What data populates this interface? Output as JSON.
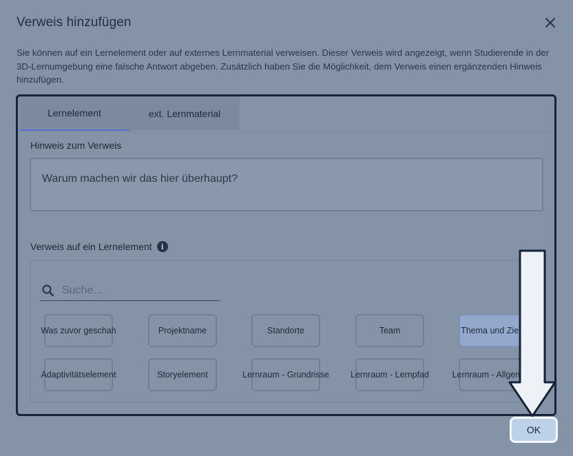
{
  "dialog": {
    "title": "Verweis hinzufügen",
    "close_icon": "close-icon",
    "description": "Sie können auf ein Lernelement oder auf externes Lernmaterial verweisen. Dieser Verweis wird angezeigt, wenn Studierende in der 3D-Lernumgebung eine falsche Antwort abgeben. Zusätzlich haben Sie die Möglichkeit, dem Verweis einen ergänzenden Hinweis hinzufügen."
  },
  "tabs": [
    {
      "label": "Lernelement"
    },
    {
      "label": "ext. Lernmaterial"
    }
  ],
  "hint": {
    "label": "Hinweis zum Verweis",
    "value": "Warum machen wir das hier überhaupt?"
  },
  "reference": {
    "label": "Verweis auf ein Lernelement",
    "info_icon": "info-icon",
    "search_placeholder": "Suche...",
    "elements": [
      {
        "label": "Was zuvor geschah",
        "selected": false
      },
      {
        "label": "Projektname",
        "selected": false
      },
      {
        "label": "Standorte",
        "selected": false
      },
      {
        "label": "Team",
        "selected": false
      },
      {
        "label": "Thema und Ziele",
        "selected": true
      },
      {
        "label": "Adaptivitätselement",
        "selected": false
      },
      {
        "label": "Storyelement",
        "selected": false
      },
      {
        "label": "Lernraum - Grundrisse",
        "selected": false
      },
      {
        "label": "Lernraum - Lernpfad",
        "selected": false
      },
      {
        "label": "Lernraum - Allgemein",
        "selected": false
      }
    ]
  },
  "footer": {
    "ok_label": "OK"
  },
  "colors": {
    "overlay": "#8593a6",
    "accent_tab": "#5b6bd6",
    "ok_button": "#bdd2e6",
    "arrow": "#eef1f5"
  }
}
